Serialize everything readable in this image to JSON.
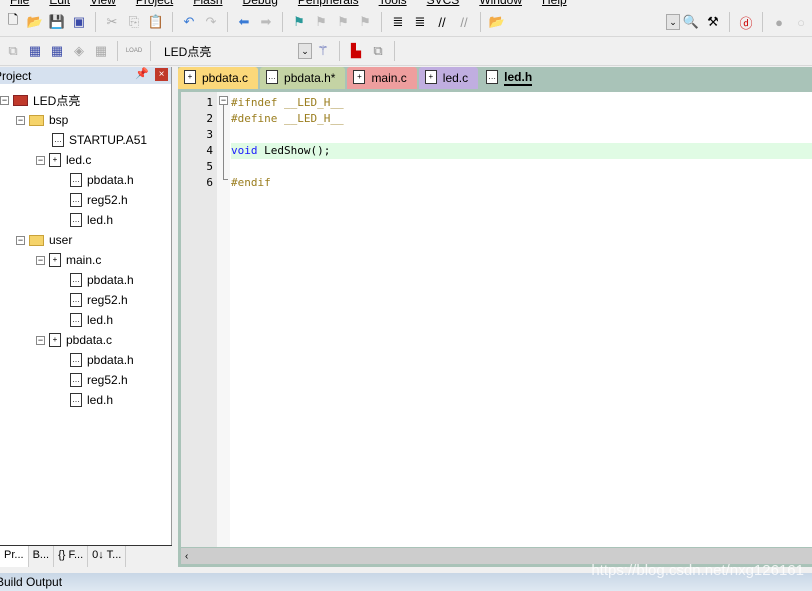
{
  "menu": [
    "File",
    "Edit",
    "View",
    "Project",
    "Flash",
    "Debug",
    "Peripherals",
    "Tools",
    "SVCS",
    "Window",
    "Help"
  ],
  "toolbar2": {
    "target": "LED点亮",
    "load_label": "LOAD"
  },
  "project": {
    "title": "Project",
    "tree": [
      {
        "label": "LED点亮",
        "level": 0,
        "type": "root"
      },
      {
        "label": "bsp",
        "level": 1,
        "type": "folder"
      },
      {
        "label": "STARTUP.A51",
        "level": 2,
        "type": "file"
      },
      {
        "label": "led.c",
        "level": 2,
        "type": "cfile"
      },
      {
        "label": "pbdata.h",
        "level": 3,
        "type": "file"
      },
      {
        "label": "reg52.h",
        "level": 3,
        "type": "file"
      },
      {
        "label": "led.h",
        "level": 3,
        "type": "file"
      },
      {
        "label": "user",
        "level": 1,
        "type": "folder"
      },
      {
        "label": "main.c",
        "level": 2,
        "type": "cfile"
      },
      {
        "label": "pbdata.h",
        "level": 3,
        "type": "file"
      },
      {
        "label": "reg52.h",
        "level": 3,
        "type": "file"
      },
      {
        "label": "led.h",
        "level": 3,
        "type": "file"
      },
      {
        "label": "pbdata.c",
        "level": 2,
        "type": "cfile"
      },
      {
        "label": "pbdata.h",
        "level": 3,
        "type": "file"
      },
      {
        "label": "reg52.h",
        "level": 3,
        "type": "file"
      },
      {
        "label": "led.h",
        "level": 3,
        "type": "file"
      }
    ],
    "bottom_tabs": [
      "Pr...",
      "B...",
      "{} F...",
      "0↓ T..."
    ]
  },
  "tabs": [
    {
      "label": "pbdata.c",
      "color": "#fbd87a"
    },
    {
      "label": "pbdata.h*",
      "color": "#c4d3a4"
    },
    {
      "label": "main.c",
      "color": "#ee9e9e"
    },
    {
      "label": "led.c",
      "color": "#c0aee0"
    },
    {
      "label": "led.h",
      "color": "#a9c3b8",
      "active": true
    }
  ],
  "code": [
    {
      "n": "1",
      "text": "#ifndef __LED_H__",
      "kind": "pp"
    },
    {
      "n": "2",
      "text": "#define __LED_H__",
      "kind": "pp"
    },
    {
      "n": "3",
      "text": "",
      "kind": "plain"
    },
    {
      "n": "4",
      "text": "void LedShow();",
      "kind": "code",
      "current": true
    },
    {
      "n": "5",
      "text": "",
      "kind": "plain"
    },
    {
      "n": "6",
      "text": "#endif",
      "kind": "pp"
    }
  ],
  "build_output": "Build Output",
  "watermark": "https://blog.csdn.net/nxg126161"
}
